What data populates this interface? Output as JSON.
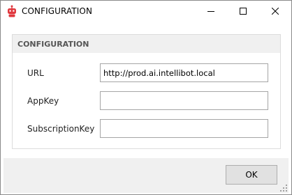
{
  "window": {
    "title": "CONFIGURATION",
    "app_icon": "robot-icon",
    "accent_color": "#e0383e",
    "controls": [
      "minimize-icon",
      "maximize-icon",
      "close-icon"
    ]
  },
  "group": {
    "title": "CONFIGURATION"
  },
  "fields": [
    {
      "label": "URL",
      "value": "http://prod.ai.intellibot.local"
    },
    {
      "label": "AppKey",
      "value": ""
    },
    {
      "label": "SubscriptionKey",
      "value": ""
    }
  ],
  "footer": {
    "ok_label": "OK",
    "grip_icon": "resize-grip-icon"
  }
}
